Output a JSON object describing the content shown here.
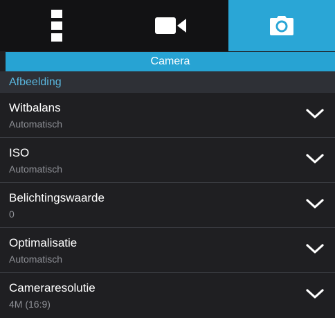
{
  "tabs": [
    {
      "icon": "menu-icon",
      "active": false
    },
    {
      "icon": "video-camera-icon",
      "active": false
    },
    {
      "icon": "camera-icon",
      "active": true
    }
  ],
  "header": {
    "title": "Camera"
  },
  "category": {
    "label": "Afbeelding"
  },
  "settings": [
    {
      "title": "Witbalans",
      "value": "Automatisch",
      "icon": "chevron-down-icon"
    },
    {
      "title": "ISO",
      "value": "Automatisch",
      "icon": "chevron-down-icon"
    },
    {
      "title": "Belichtingswaarde",
      "value": "0",
      "icon": "chevron-down-icon"
    },
    {
      "title": "Optimalisatie",
      "value": "Automatisch",
      "icon": "chevron-down-icon"
    },
    {
      "title": "Cameraresolutie",
      "value": "4M (16:9)",
      "icon": "chevron-down-icon"
    }
  ],
  "colors": {
    "accent": "#2aa6d6",
    "category_text": "#5ab8e0",
    "background": "#1f1f22",
    "tabbar": "#121214"
  }
}
